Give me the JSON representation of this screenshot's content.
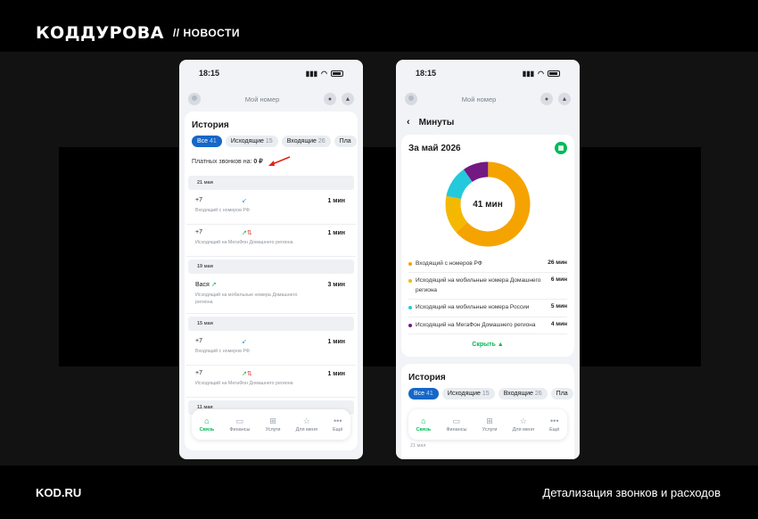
{
  "header": {
    "logo": "КОДДУРОВА",
    "section": "// НОВОСТИ"
  },
  "footer": {
    "site": "KOD.RU",
    "caption": "Детализация звонков и расходов"
  },
  "phone1": {
    "status": {
      "time": "18:15"
    },
    "topbar": {
      "title": "Мой номер"
    },
    "history": {
      "title": "История",
      "chips": [
        {
          "label": "Все",
          "count": "41"
        },
        {
          "label": "Исходящие",
          "count": "15"
        },
        {
          "label": "Входящие",
          "count": "26"
        },
        {
          "label": "Пла",
          "count": ""
        }
      ],
      "paid_label": "Платных звонков на:",
      "paid_value": "0 ₽",
      "groups": [
        {
          "date": "21 мая",
          "rows": [
            {
              "number": "+7",
              "duration": "1 мин",
              "desc": "Входящий с номеров РФ"
            },
            {
              "number": "+7",
              "duration": "1 мин",
              "desc": "Исходящий на МегаФон Домашнего региона"
            }
          ]
        },
        {
          "date": "19 мая",
          "rows": [
            {
              "number": "Вася",
              "duration": "3 мин",
              "desc": "Исходящий на мобильные номера Домашнего региона"
            }
          ]
        },
        {
          "date": "15 мая",
          "rows": [
            {
              "number": "+7",
              "duration": "1 мин",
              "desc": "Входящий с номеров РФ"
            },
            {
              "number": "+7",
              "duration": "1 мин",
              "desc": "Исходящий на МегаФон Домашнего региона"
            }
          ]
        },
        {
          "date": "11 мая",
          "rows": []
        }
      ]
    }
  },
  "tabbar": [
    "Связь",
    "Финансы",
    "Услуги",
    "Для меня",
    "Ещё"
  ],
  "phone2": {
    "status": {
      "time": "18:15"
    },
    "topbar": {
      "title": "Мой номер"
    },
    "page_title": "Минуты",
    "period_title": "За май 2026",
    "total": "41 мин",
    "breakdown": [
      {
        "label": "Входящий с номеров РФ",
        "value": "26 мин",
        "color": "#f5a300"
      },
      {
        "label": "Исходящий на мобильные номера Домашнего региона",
        "value": "6 мин",
        "color": "#f5b800"
      },
      {
        "label": "Исходящий на мобильные номера России",
        "value": "5 мин",
        "color": "#24c9db"
      },
      {
        "label": "Исходящий на МегаФон Домашнего региона",
        "value": "4 мин",
        "color": "#731982"
      }
    ],
    "hide_label": "Скрыть",
    "history": {
      "title": "История",
      "chips": [
        {
          "label": "Все",
          "count": "41"
        },
        {
          "label": "Исходящие",
          "count": "15"
        },
        {
          "label": "Входящие",
          "count": "26"
        },
        {
          "label": "Пла",
          "count": ""
        }
      ],
      "faint_date": "21 мая"
    }
  },
  "chart_data": {
    "type": "pie",
    "categories": [
      "Входящий с номеров РФ",
      "Исходящий на мобильные номера Домашнего региона",
      "Исходящий на мобильные номера России",
      "Исходящий на МегаФон Домашнего региона"
    ],
    "values": [
      26,
      6,
      5,
      4
    ],
    "title": "",
    "colors": [
      "#f5a300",
      "#f5b800",
      "#24c9db",
      "#731982"
    ]
  }
}
